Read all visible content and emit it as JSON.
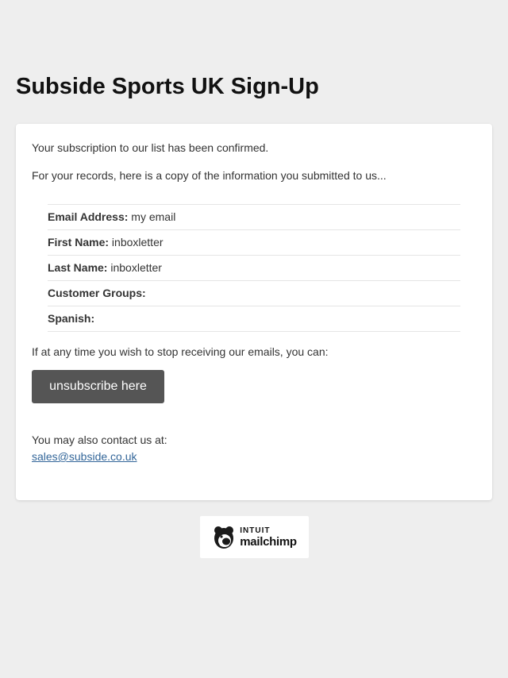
{
  "page": {
    "title": "Subside Sports UK Sign-Up"
  },
  "card": {
    "confirmation_text": "Your subscription to our list has been confirmed.",
    "records_text": "For your records, here is a copy of the information you submitted to us...",
    "fields": [
      {
        "label": "Email Address:",
        "value": "my email"
      },
      {
        "label": "First Name:",
        "value": "inboxletter"
      },
      {
        "label": "Last Name:",
        "value": "inboxletter"
      },
      {
        "label": "Customer Groups:",
        "value": ""
      },
      {
        "label": "Spanish:",
        "value": ""
      }
    ],
    "stop_text": "If at any time you wish to stop receiving our emails, you can:",
    "unsubscribe_label": "unsubscribe here",
    "contact_text": "You may also contact us at:",
    "contact_email": "sales@subside.co.uk"
  },
  "footer": {
    "badge_brand_top": "Intuit",
    "badge_brand_main": "mailchimp",
    "badge_icon": "mailchimp-freddie-icon"
  },
  "colors": {
    "background": "#eeeeee",
    "card": "#ffffff",
    "button": "#555555",
    "link": "#336699"
  }
}
